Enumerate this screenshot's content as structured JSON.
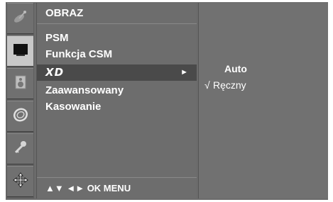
{
  "sidebar": {
    "items": [
      {
        "icon": "satellite-icon",
        "active": false
      },
      {
        "icon": "screen-icon",
        "active": true
      },
      {
        "icon": "speaker-icon",
        "active": false
      },
      {
        "icon": "clock-icon",
        "active": false
      },
      {
        "icon": "key-icon",
        "active": false
      },
      {
        "icon": "cursor-icon",
        "active": false
      }
    ]
  },
  "menu": {
    "title": "OBRAZ",
    "items": [
      {
        "label": "PSM"
      },
      {
        "label": "Funkcja CSM"
      },
      {
        "label": "XD",
        "selected": true,
        "arrow": "►"
      },
      {
        "label": "Zaawansowany"
      },
      {
        "label": "Kasowanie"
      }
    ],
    "footer": "▲▼  ◄►  OK  MENU"
  },
  "submenu": {
    "options": [
      {
        "label": "Auto",
        "checked": false
      },
      {
        "label": "Ręczny",
        "checked": true,
        "check": "√"
      }
    ]
  }
}
